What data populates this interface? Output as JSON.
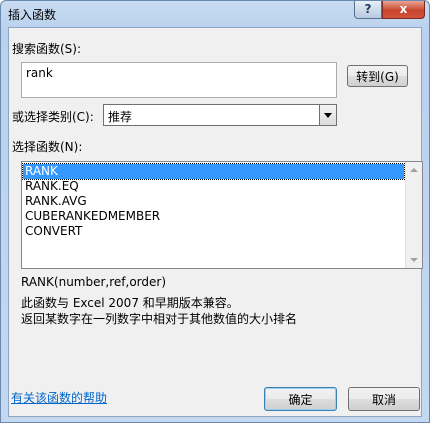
{
  "window": {
    "title": "插入函数",
    "help_button": "?",
    "close_button": "x"
  },
  "search": {
    "label": "搜索函数(S):",
    "value": "rank",
    "go_button": "转到(G)"
  },
  "category": {
    "label": "或选择类别(C):",
    "selected": "推荐"
  },
  "functions": {
    "label": "选择函数(N):",
    "items": [
      "RANK",
      "RANK.EQ",
      "RANK.AVG",
      "CUBERANKEDMEMBER",
      "CONVERT"
    ],
    "selected_index": 0
  },
  "description": {
    "signature": "RANK(number,ref,order)",
    "line1": "此函数与 Excel 2007 和早期版本兼容。",
    "line2": "返回某数字在一列数字中相对于其他数值的大小排名"
  },
  "footer": {
    "help_link": "有关该函数的帮助",
    "ok_button": "确定",
    "cancel_button": "取消"
  }
}
